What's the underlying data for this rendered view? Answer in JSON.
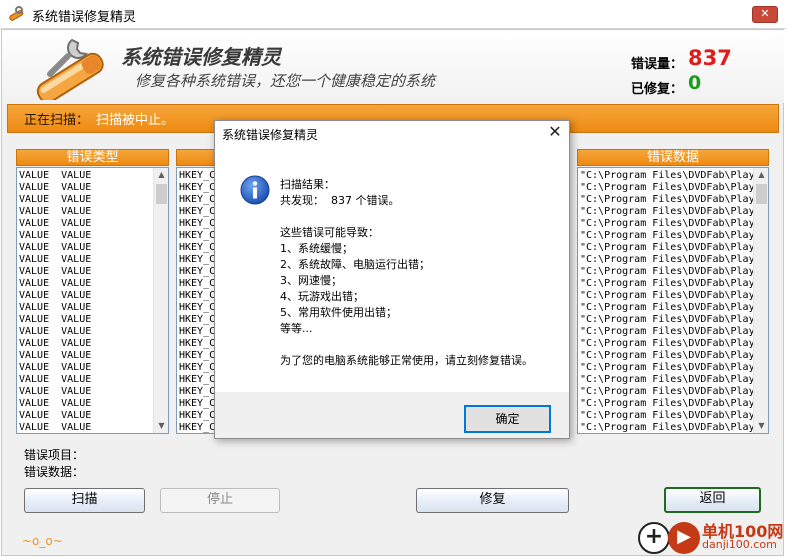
{
  "window": {
    "title": "系统错误修复精灵"
  },
  "header": {
    "app_name": "系统错误修复精灵",
    "slogan": "修复各种系统错误，还您一个健康稳定的系统",
    "errors_label": "错误量：",
    "errors_value": "837",
    "fixed_label": "已修复：",
    "fixed_value": "0"
  },
  "status": {
    "label": "正在扫描：",
    "text": "扫描被中止。"
  },
  "columns": {
    "error_type": "错误类型",
    "error_data": "错误数据"
  },
  "lists": {
    "type_rows": [
      "VALUE  VALUE",
      "VALUE  VALUE",
      "VALUE  VALUE",
      "VALUE  VALUE",
      "VALUE  VALUE",
      "VALUE  VALUE",
      "VALUE  VALUE",
      "VALUE  VALUE",
      "VALUE  VALUE",
      "VALUE  VALUE",
      "VALUE  VALUE",
      "VALUE  VALUE",
      "VALUE  VALUE",
      "VALUE  VALUE",
      "VALUE  VALUE",
      "VALUE  VALUE",
      "VALUE  VALUE",
      "VALUE  VALUE",
      "VALUE  VALUE",
      "VALUE  VALUE",
      "VALUE  VALUE",
      "VALUE  VALUE"
    ],
    "key_rows": [
      "HKEY_C",
      "HKEY_C",
      "HKEY_C",
      "HKEY_C",
      "HKEY_C",
      "HKEY_C",
      "HKEY_C",
      "HKEY_C",
      "HKEY_C",
      "HKEY_C",
      "HKEY_C",
      "HKEY_C",
      "HKEY_C",
      "HKEY_C",
      "HKEY_C",
      "HKEY_C",
      "HKEY_C",
      "HKEY_C",
      "HKEY_C",
      "HKEY_C",
      "HKEY_C",
      "HKEY_C"
    ],
    "data_rows": [
      "\"C:\\Program Files\\DVDFab\\Play",
      "\"C:\\Program Files\\DVDFab\\Play",
      "\"C:\\Program Files\\DVDFab\\Play",
      "\"C:\\Program Files\\DVDFab\\Play",
      "\"C:\\Program Files\\DVDFab\\Play",
      "\"C:\\Program Files\\DVDFab\\Play",
      "\"C:\\Program Files\\DVDFab\\Play",
      "\"C:\\Program Files\\DVDFab\\Play",
      "\"C:\\Program Files\\DVDFab\\Play",
      "\"C:\\Program Files\\DVDFab\\Play",
      "\"C:\\Program Files\\DVDFab\\Play",
      "\"C:\\Program Files\\DVDFab\\Play",
      "\"C:\\Program Files\\DVDFab\\Play",
      "\"C:\\Program Files\\DVDFab\\Play",
      "\"C:\\Program Files\\DVDFab\\Play",
      "\"C:\\Program Files\\DVDFab\\Play",
      "\"C:\\Program Files\\DVDFab\\Play",
      "\"C:\\Program Files\\DVDFab\\Play",
      "\"C:\\Program Files\\DVDFab\\Play",
      "\"C:\\Program Files\\DVDFab\\Play",
      "\"C:\\Program Files\\DVDFab\\Play",
      "\"C:\\Program Files\\DVDFab\\Play"
    ]
  },
  "details": {
    "item_label": "错误项目：",
    "data_label": "错误数据："
  },
  "buttons": {
    "scan": "扫描",
    "stop": "停止",
    "fix": "修复",
    "back": "返回"
  },
  "footer": {
    "emoticon": "~o_o~"
  },
  "watermark": {
    "plus": "+",
    "main": "单机100网",
    "sub": "danji100.com"
  },
  "dialog": {
    "title": "系统错误修复精灵",
    "close": "✕",
    "lines": [
      "扫描结果：",
      "共发现：  837 个错误。",
      "",
      "这些错误可能导致：",
      "1、系统缓慢；",
      "2、系统故障、电脑运行出错；",
      "3、网速慢；",
      "4、玩游戏出错；",
      "5、常用软件使用出错；",
      "等等...",
      "",
      "为了您的电脑系统能够正常使用，请立刻修复错误。"
    ],
    "ok": "确定"
  },
  "colors": {
    "accent_orange": "#ee8a12",
    "error_red": "#e21b1b",
    "fixed_green": "#1a9e1a",
    "dialog_focus": "#0078d7"
  },
  "icons": [
    "app-icon",
    "wrench-logo-icon",
    "info-icon",
    "close-icon",
    "scroll-up-icon",
    "scroll-down-icon"
  ]
}
